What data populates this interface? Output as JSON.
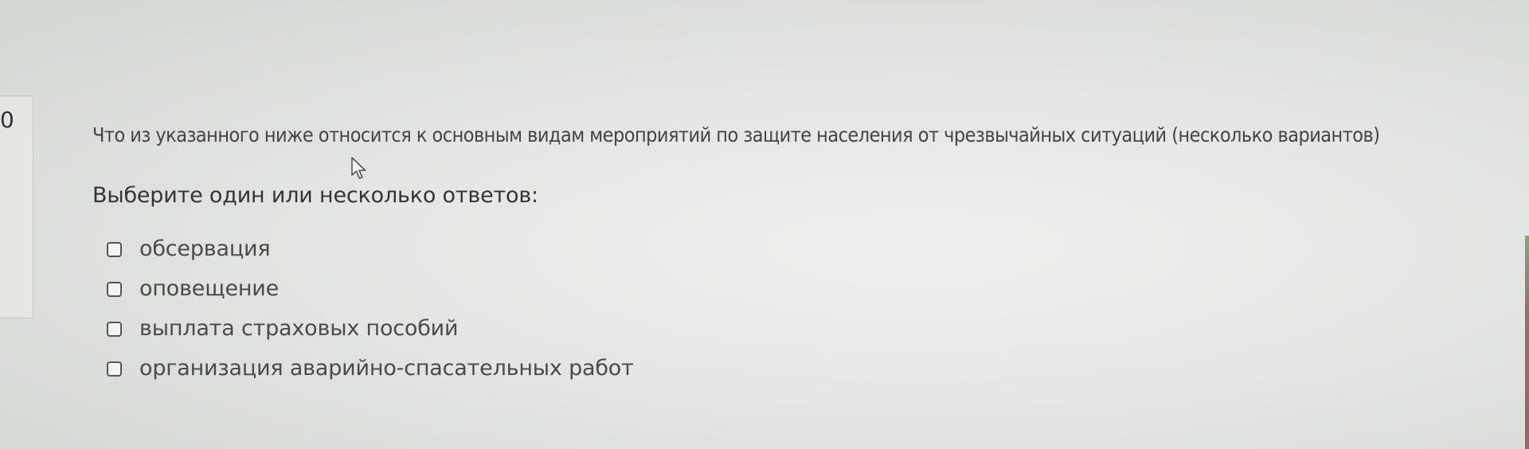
{
  "question": {
    "number": "0",
    "text": "Что из указанного ниже относится к основным видам мероприятий по защите населения от чрезвычайных ситуаций (несколько вариантов)",
    "prompt": "Выберите один или несколько ответов:",
    "options": [
      {
        "label": "обсервация",
        "checked": false
      },
      {
        "label": "оповещение",
        "checked": false
      },
      {
        "label": "выплата страховых пособий",
        "checked": false
      },
      {
        "label": "организация аварийно-спасательных работ",
        "checked": false
      }
    ]
  },
  "icons": {
    "cursor": "mouse-pointer-icon"
  },
  "colors": {
    "text": "#444444",
    "checkbox_border": "#555555",
    "background": "#e3e6e2"
  }
}
